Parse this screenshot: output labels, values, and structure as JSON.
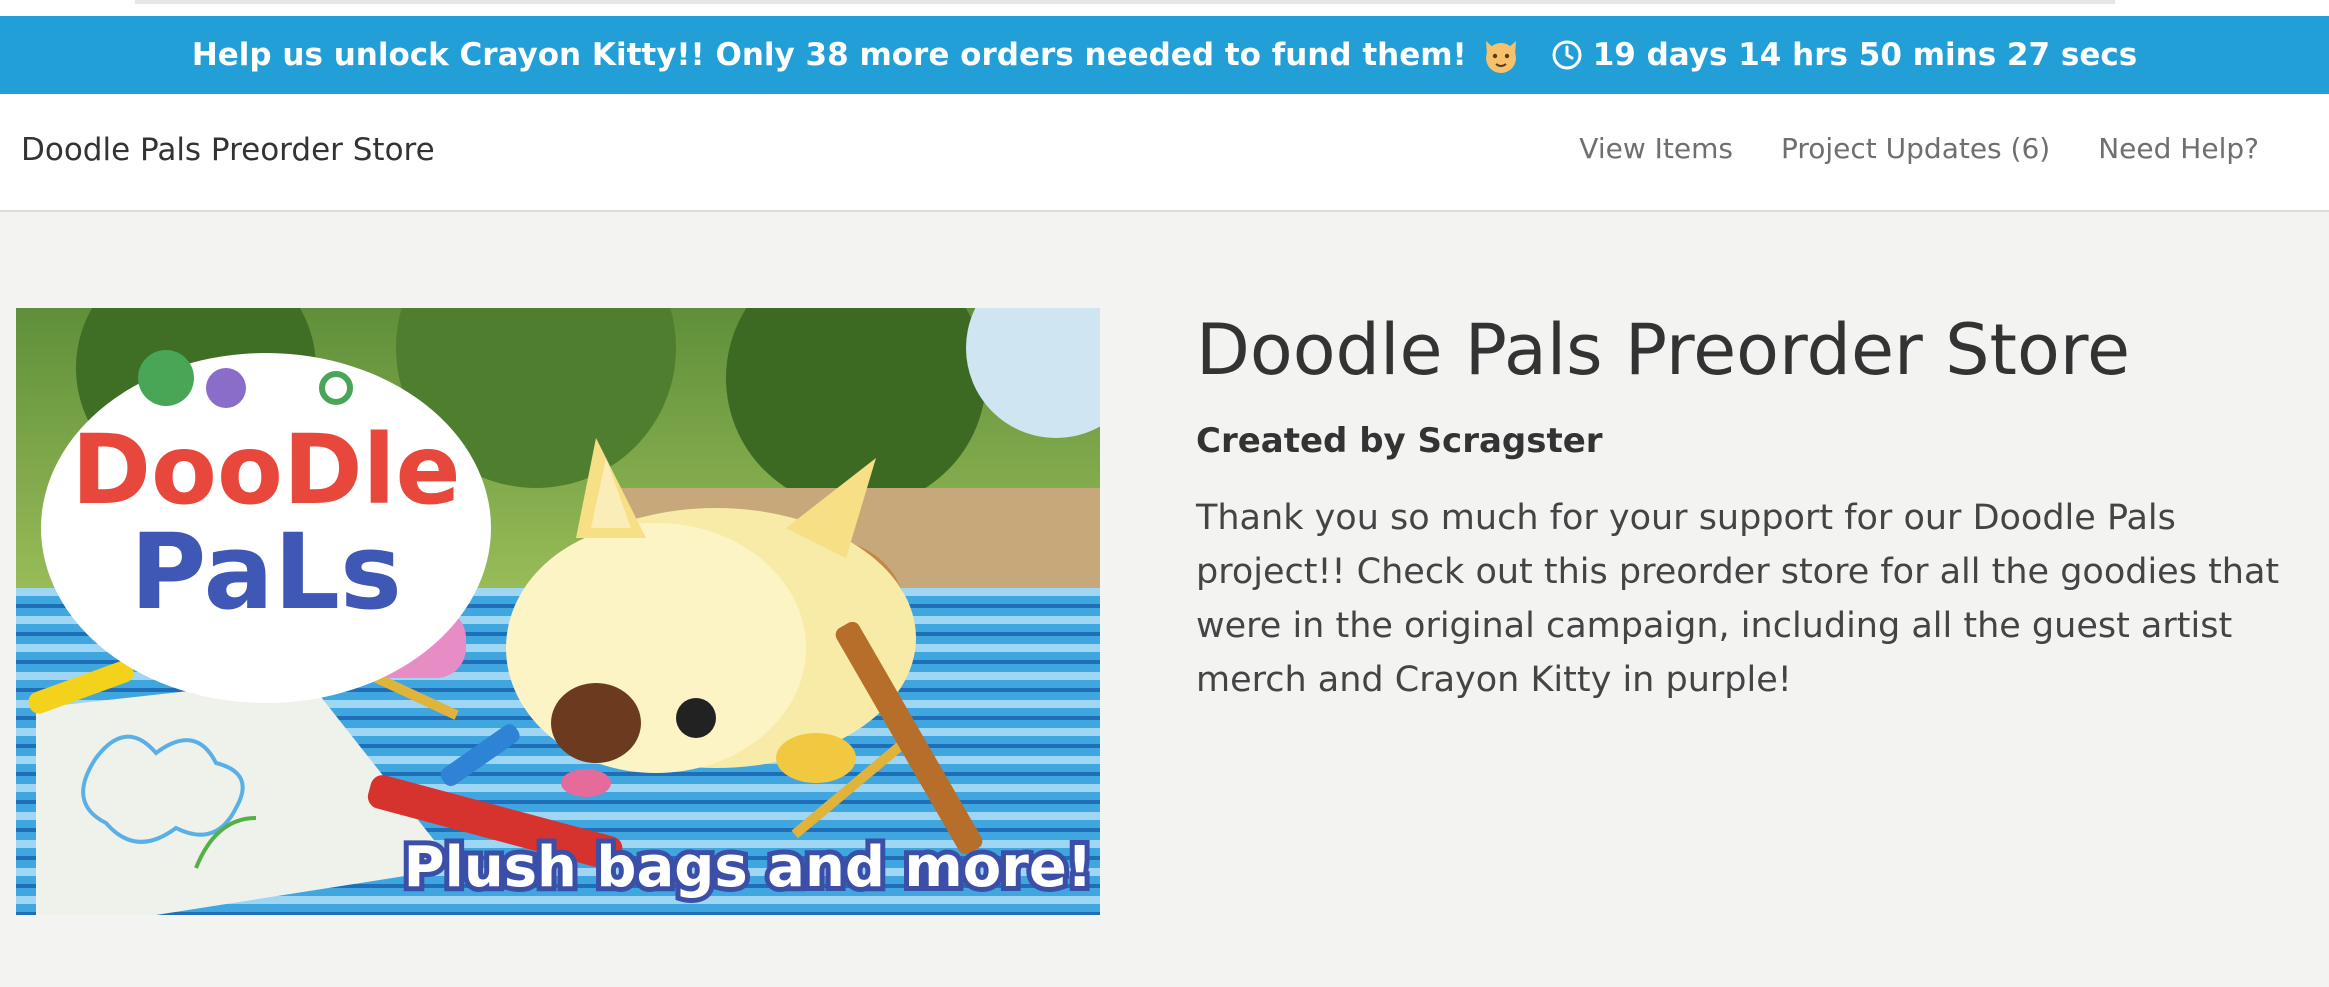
{
  "banner": {
    "message": "Help us unlock Crayon Kitty!! Only 38 more orders needed to fund them!",
    "countdown": "19 days 14 hrs 50 mins 27 secs",
    "cat_icon": "cat-face-icon",
    "clock_icon": "clock-icon",
    "color": "#219fd6"
  },
  "nav": {
    "brand": "Doodle Pals Preorder Store",
    "links": [
      "View Items",
      "Project Updates (6)",
      "Need Help?"
    ]
  },
  "hero": {
    "logo_line1": "DooDle",
    "logo_line2": "PaLs",
    "caption": "Plush bags and more!"
  },
  "main": {
    "title": "Doodle Pals Preorder Store",
    "creator": "Created by Scragster",
    "description": "Thank you so much for your support for our Doodle Pals project!! Check out this preorder store for all the goodies that were in the original campaign, including all the guest artist merch and Crayon Kitty in purple!"
  }
}
